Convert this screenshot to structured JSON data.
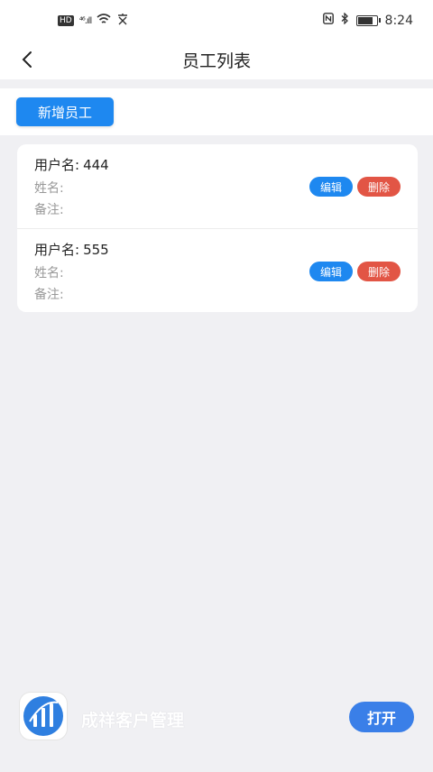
{
  "status_bar": {
    "hd_badge": "HD",
    "signal_text": "⁴⁶.ıll",
    "time": "8:24",
    "icons": [
      "wifi-icon",
      "nfc-icon",
      "bluetooth-icon",
      "battery-icon"
    ]
  },
  "nav": {
    "title": "员工列表",
    "back_icon": "chevron-left-icon"
  },
  "toolbar": {
    "add_label": "新增员工"
  },
  "employees": [
    {
      "username_label": "用户名:",
      "username": "444",
      "name_label": "姓名:",
      "remark_label": "备注:",
      "edit_label": "编辑",
      "delete_label": "删除"
    },
    {
      "username_label": "用户名:",
      "username": "555",
      "name_label": "姓名:",
      "remark_label": "备注:",
      "edit_label": "编辑",
      "delete_label": "删除"
    }
  ],
  "app_banner": {
    "name": "成祥客户管理",
    "open_label": "打开"
  },
  "colors": {
    "primary": "#1e88f0",
    "danger": "#e25545",
    "background": "#f0f0f3"
  }
}
